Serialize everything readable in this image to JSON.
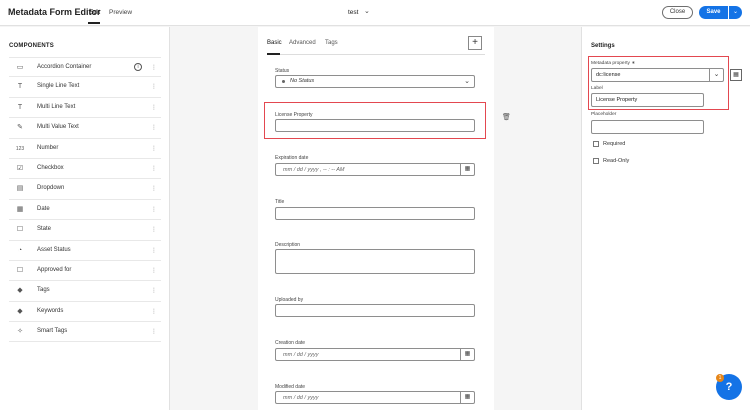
{
  "app": {
    "title": "Metadata Form Editor",
    "mode_tabs": [
      "Edit",
      "Preview"
    ],
    "doc_name": "test"
  },
  "actions": {
    "close": "Close",
    "save": "Save"
  },
  "components": {
    "heading": "COMPONENTS",
    "items": [
      {
        "label": "Accordion Container",
        "icon": "accordion-icon"
      },
      {
        "label": "Single Line Text",
        "icon": "text-icon"
      },
      {
        "label": "Multi Line Text",
        "icon": "text-icon"
      },
      {
        "label": "Multi Value Text",
        "icon": "pencil-icon"
      },
      {
        "label": "Number",
        "icon": "number-icon"
      },
      {
        "label": "Checkbox",
        "icon": "checkbox-icon"
      },
      {
        "label": "Dropdown",
        "icon": "dropdown-icon"
      },
      {
        "label": "Date",
        "icon": "calendar-icon"
      },
      {
        "label": "State",
        "icon": "state-icon"
      },
      {
        "label": "Asset Status",
        "icon": "asset-status-icon"
      },
      {
        "label": "Approved for",
        "icon": "approved-icon"
      },
      {
        "label": "Tags",
        "icon": "tag-icon"
      },
      {
        "label": "Keywords",
        "icon": "tag-icon"
      },
      {
        "label": "Smart Tags",
        "icon": "smart-tag-icon"
      }
    ]
  },
  "form": {
    "tabs": [
      "Basic",
      "Advanced",
      "Tags"
    ],
    "status": {
      "label": "Status",
      "value": "No Status"
    },
    "license": {
      "label": "License Property"
    },
    "expiration": {
      "label": "Expiration date",
      "placeholder": "mm / dd / yyyy ,  -- : --  AM"
    },
    "title": {
      "label": "Title"
    },
    "description": {
      "label": "Description"
    },
    "uploaded_by": {
      "label": "Uploaded by"
    },
    "creation": {
      "label": "Creation date",
      "placeholder": "mm / dd / yyyy"
    },
    "modified": {
      "label": "Modified date",
      "placeholder": "mm / dd / yyyy"
    }
  },
  "settings": {
    "heading": "Settings",
    "metadata_property_label": "Metadata property",
    "metadata_property_value": "dc:license",
    "label_label": "Label",
    "label_value": "License Property",
    "placeholder_label": "Placeholder",
    "required_label": "Required",
    "readonly_label": "Read-Only"
  },
  "help": {
    "badge": "1",
    "icon": "?"
  },
  "colors": {
    "accent": "#1473e6",
    "highlight": "#e34850"
  }
}
